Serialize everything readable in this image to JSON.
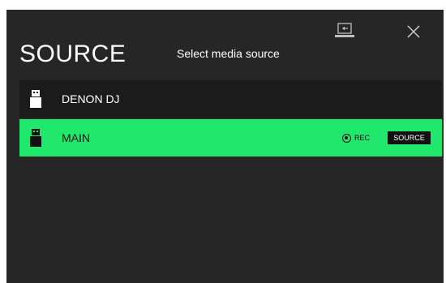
{
  "dialog": {
    "title": "SOURCE",
    "subtitle": "Select media source",
    "icons": {
      "computer": "computer-icon",
      "close": "close-icon",
      "usb": "usb-drive-icon"
    }
  },
  "sources": [
    {
      "label": "DENON DJ",
      "selected": false
    },
    {
      "label": "MAIN",
      "selected": true,
      "rec_label": "REC",
      "source_button": "SOURCE"
    }
  ],
  "colors": {
    "background": "#262626",
    "row": "#1b1b1b",
    "accent": "#1fe86c"
  }
}
